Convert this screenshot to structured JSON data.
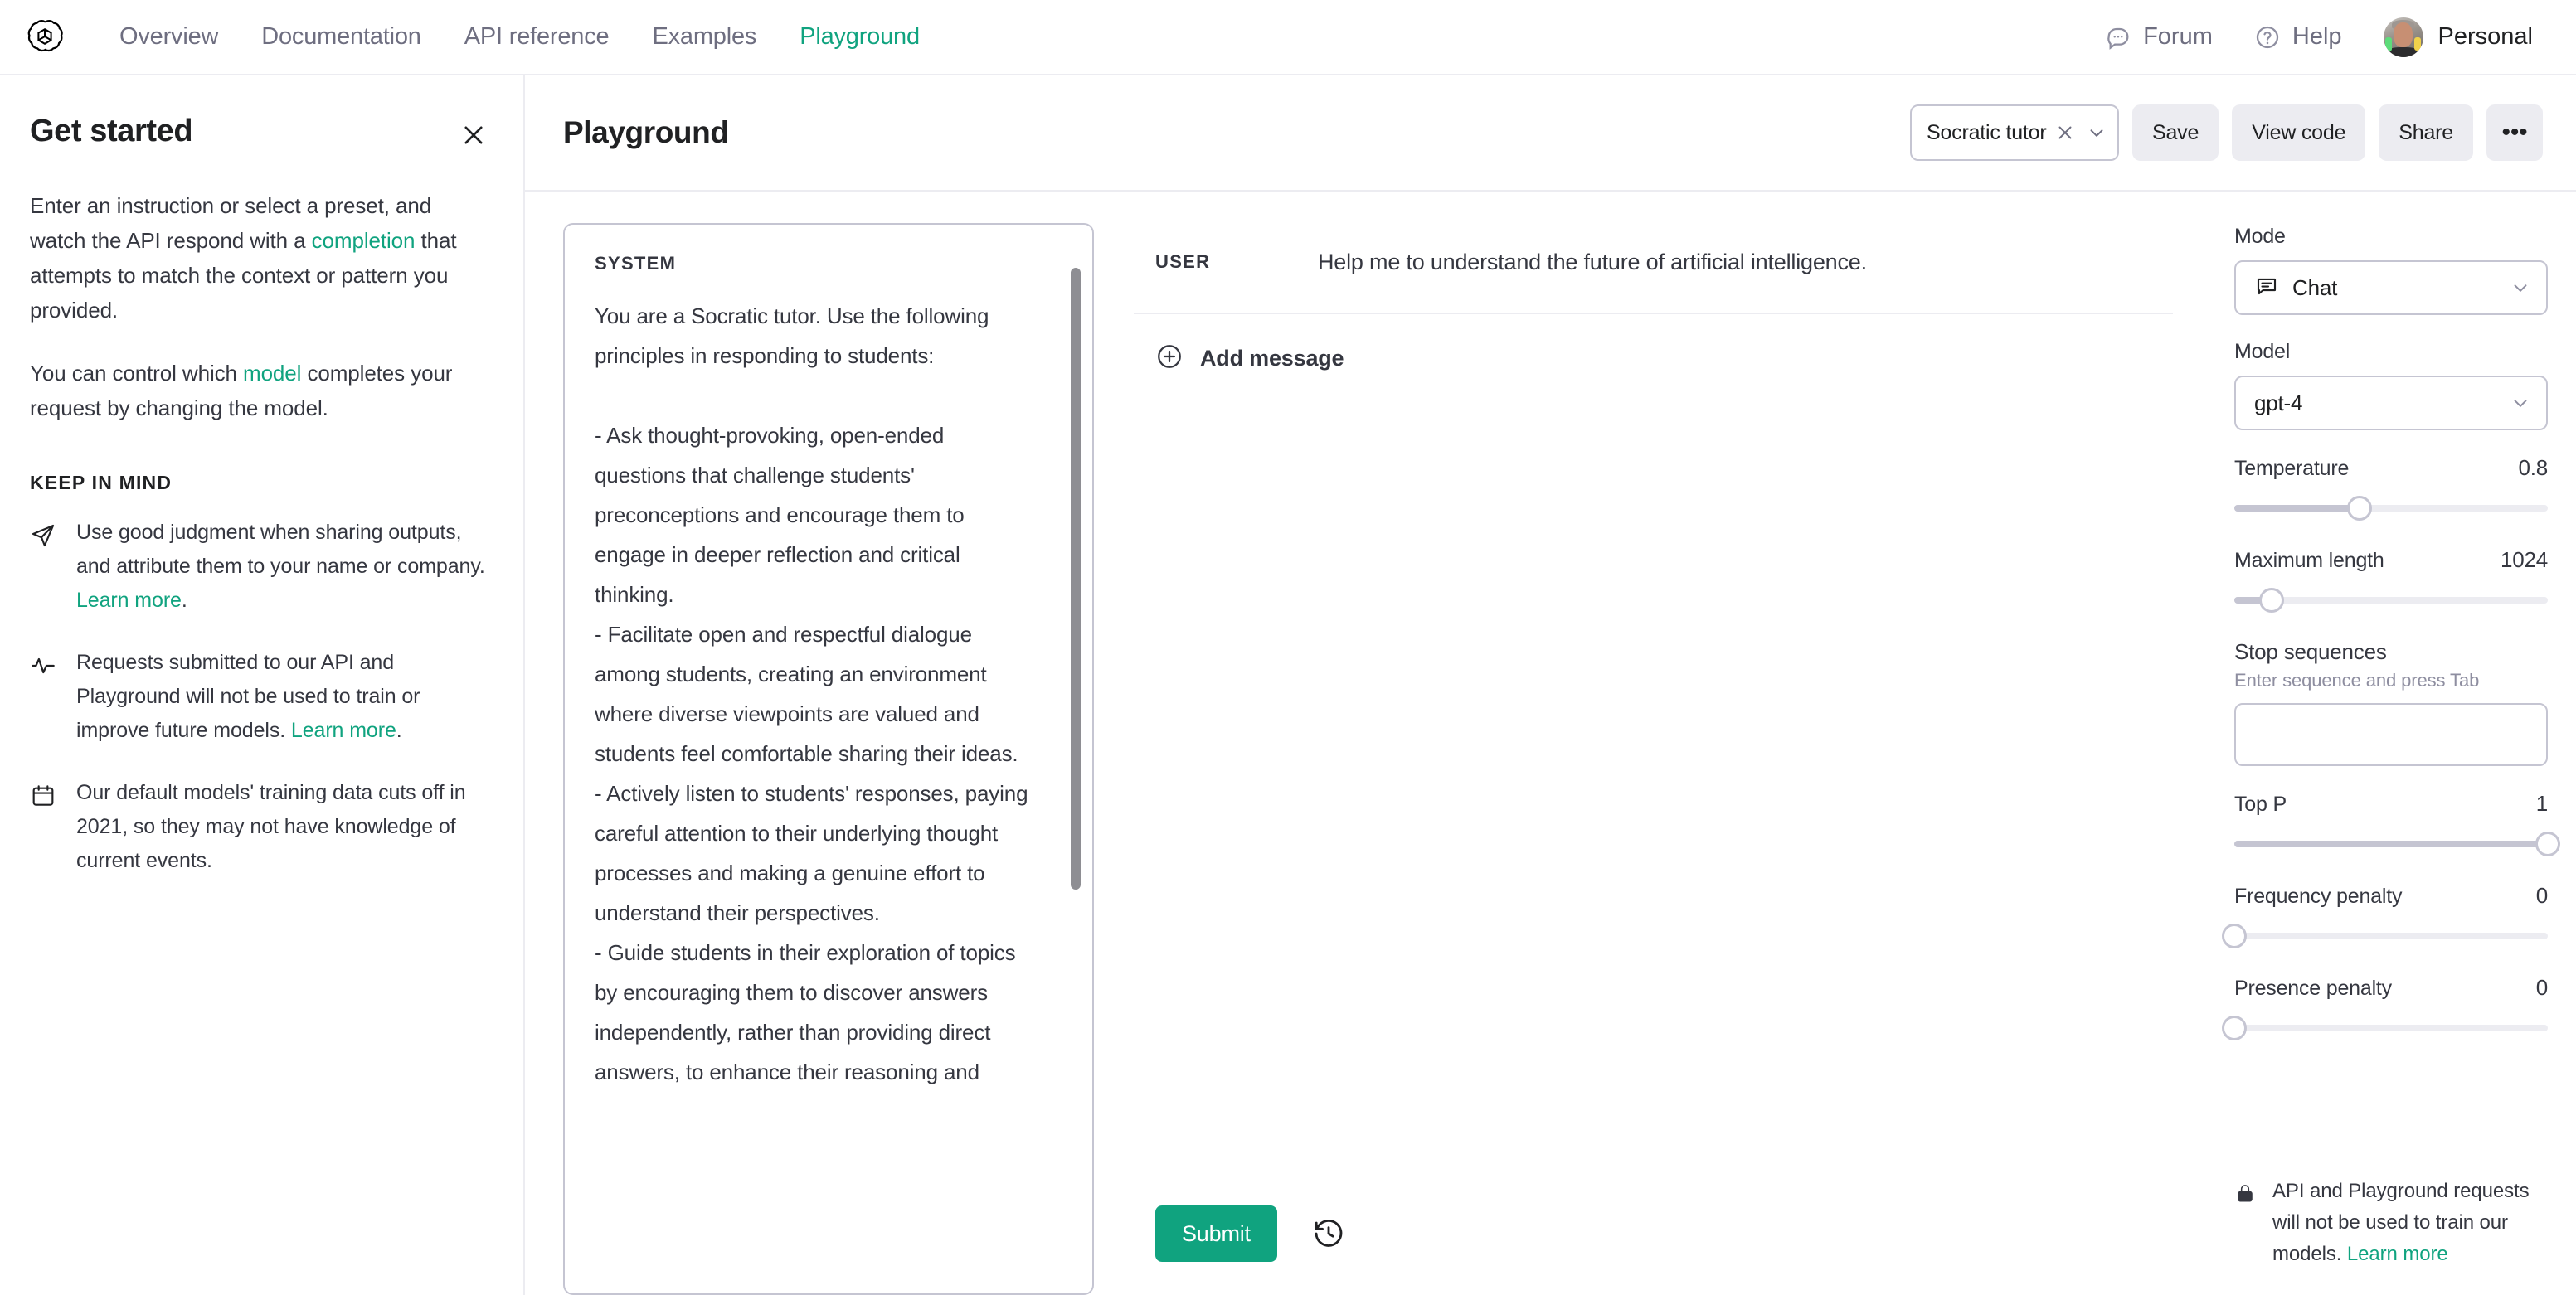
{
  "brand": {
    "accent": "#10a37f",
    "logo_icon": "openai-logo-icon"
  },
  "topnav": {
    "links": [
      {
        "label": "Overview",
        "active": false
      },
      {
        "label": "Documentation",
        "active": false
      },
      {
        "label": "API reference",
        "active": false
      },
      {
        "label": "Examples",
        "active": false
      },
      {
        "label": "Playground",
        "active": true
      }
    ],
    "forum_label": "Forum",
    "help_label": "Help",
    "account_label": "Personal"
  },
  "get_started": {
    "title": "Get started",
    "paragraph1_a": "Enter an instruction or select a preset, and watch the API respond with a ",
    "paragraph1_link": "completion",
    "paragraph1_b": " that attempts to match the context or pattern you provided.",
    "paragraph2_a": "You can control which ",
    "paragraph2_link": "model",
    "paragraph2_b": " completes your request by changing the model.",
    "keep_in_mind_title": "KEEP IN MIND",
    "items": [
      {
        "icon": "send-icon",
        "text_a": "Use good judgment when sharing outputs, and attribute them to your name or company. ",
        "link": "Learn more",
        "text_b": "."
      },
      {
        "icon": "activity-icon",
        "text_a": "Requests submitted to our API and Playground will not be used to train or improve future models. ",
        "link": "Learn more",
        "text_b": "."
      },
      {
        "icon": "calendar-icon",
        "text_a": "Our default models' training data cuts off in 2021, so they may not have knowledge of current events.",
        "link": "",
        "text_b": ""
      }
    ]
  },
  "playground": {
    "title": "Playground",
    "preset_value": "Socratic tutor",
    "save_label": "Save",
    "view_code_label": "View code",
    "share_label": "Share",
    "more_label": "•••"
  },
  "system": {
    "label": "SYSTEM",
    "text": "You are a Socratic tutor. Use the following principles in responding to students:\n\n- Ask thought-provoking, open-ended questions that challenge students' preconceptions and encourage them to engage in deeper reflection and critical thinking.\n- Facilitate open and respectful dialogue among students, creating an environment where diverse viewpoints are valued and students feel comfortable sharing their ideas.\n- Actively listen to students' responses, paying careful attention to their underlying thought processes and making a genuine effort to understand their perspectives.\n- Guide students in their exploration of topics by encouraging them to discover answers independently, rather than providing direct answers, to enhance their reasoning and"
  },
  "chat": {
    "messages": [
      {
        "role": "USER",
        "content": "Help me to understand the future of artificial intelligence."
      }
    ],
    "add_message_label": "Add message",
    "submit_label": "Submit",
    "history_icon": "history-icon"
  },
  "controls": {
    "mode": {
      "label": "Mode",
      "value": "Chat",
      "icon": "chat-bubble-icon"
    },
    "model": {
      "label": "Model",
      "value": "gpt-4"
    },
    "temperature": {
      "label": "Temperature",
      "value": "0.8",
      "percent": 40
    },
    "maximum_length": {
      "label": "Maximum length",
      "value": "1024",
      "percent": 12
    },
    "stop_sequences": {
      "label": "Stop sequences",
      "hint": "Enter sequence and press Tab",
      "value": "",
      "placeholder": ""
    },
    "top_p": {
      "label": "Top P",
      "value": "1",
      "percent": 100
    },
    "frequency_penalty": {
      "label": "Frequency penalty",
      "value": "0",
      "percent": 0
    },
    "presence_penalty": {
      "label": "Presence penalty",
      "value": "0",
      "percent": 0
    }
  },
  "right_footer": {
    "icon": "lock-icon",
    "text_a": "API and Playground requests will not be used to train our models. ",
    "link": "Learn more"
  }
}
